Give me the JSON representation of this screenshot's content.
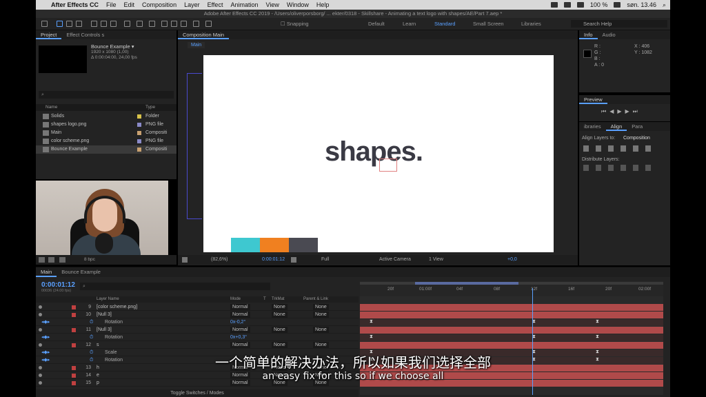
{
  "menubar": {
    "app": "After Effects CC",
    "items": [
      "File",
      "Edit",
      "Composition",
      "Layer",
      "Effect",
      "Animation",
      "View",
      "Window",
      "Help"
    ],
    "battery": "100 %",
    "clock": "søn. 13.46"
  },
  "window": {
    "title": "Adobe After Effects CC 2019 - /Users/oliverporsborg/ ... ekter/0318 - Skillshare - Animating a text logo with shapes/AE/Part 7.aep *"
  },
  "toolbar": {
    "snapping": "Snapping",
    "workspaces": [
      "Default",
      "Learn",
      "Standard",
      "Small Screen",
      "Libraries"
    ],
    "active_workspace": "Standard",
    "search_placeholder": "Search Help"
  },
  "project": {
    "tabs": [
      "Project",
      "Effect Controls s"
    ],
    "selected_name": "Bounce Example ▾",
    "selected_info": [
      "1920 x 1080 (1,00)",
      "Δ 0:00:04:00, 24,00 fps"
    ],
    "search_placeholder": "⌕",
    "col_name": "Name",
    "col_type": "Type",
    "items": [
      {
        "name": "Solids",
        "type": "Folder",
        "color": "#d8c24a"
      },
      {
        "name": "shapes logo.png",
        "type": "PNG file",
        "color": "#8a8ac8"
      },
      {
        "name": "Main",
        "type": "Compositi",
        "color": "#c8a070"
      },
      {
        "name": "color scheme.png",
        "type": "PNG file",
        "color": "#8a8ac8"
      },
      {
        "name": "Bounce Example",
        "type": "Compositi",
        "color": "#c8a070"
      }
    ],
    "bpc": "8 bpc"
  },
  "composition": {
    "tab": "Composition Main",
    "breadcrumb": "Main",
    "logo_text": "shapes",
    "logo_dot": ".",
    "swatches": [
      "#3ec8d0",
      "#f08020",
      "#4a4a52"
    ],
    "zoom": "(82,6%)",
    "timecode": "0:00:01:12",
    "resolution": "Full",
    "camera": "Active Camera",
    "views": "1 View",
    "exposure": "+0,0"
  },
  "info": {
    "tabs": [
      "Info",
      "Audio"
    ],
    "labels": [
      "R :",
      "G :",
      "B :",
      "A : 0"
    ],
    "x": "X : 406",
    "y": "Y : 1082"
  },
  "preview": {
    "title": "Preview"
  },
  "align": {
    "tabs": [
      "ibraries",
      "Align",
      "Para"
    ],
    "align_to_label": "Align Layers to:",
    "align_to_value": "Composition",
    "distribute": "Distribute Layers:"
  },
  "timeline": {
    "tabs": [
      "Main",
      "Bounce Example"
    ],
    "time": "0:00:01:12",
    "fps": "00036 (24.00 fps)",
    "headers": {
      "layer": "Layer Name",
      "mode": "Mode",
      "t": "T",
      "trkmat": "TrkMat",
      "parent": "Parent & Link"
    },
    "ruler": [
      "20f",
      "01:00f",
      "04f",
      "08f",
      "12f",
      "16f",
      "20f",
      "02:00f"
    ],
    "rows": [
      {
        "num": "9",
        "name": "[color scheme.png]",
        "mode": "Normal",
        "trk": "None",
        "parent": "None"
      },
      {
        "num": "10",
        "name": "[Null 3]",
        "mode": "Normal",
        "trk": "None",
        "parent": "None"
      },
      {
        "prop": "Rotation",
        "value": "0x-0,2°"
      },
      {
        "num": "11",
        "name": "[Null 3]",
        "mode": "Normal",
        "trk": "None",
        "parent": "None"
      },
      {
        "prop": "Rotation",
        "value": "0x+0,3°"
      },
      {
        "num": "12",
        "name": "s",
        "mode": "Normal",
        "trk": "None",
        "parent": "None"
      },
      {
        "prop": "Scale",
        "value": ""
      },
      {
        "prop": "Rotation",
        "value": ""
      },
      {
        "num": "13",
        "name": "h",
        "mode": "Normal",
        "trk": "None",
        "parent": "None"
      },
      {
        "num": "14",
        "name": "e",
        "mode": "Normal",
        "trk": "None",
        "parent": "None"
      },
      {
        "num": "15",
        "name": "p",
        "mode": "Normal",
        "trk": "None",
        "parent": "None"
      }
    ],
    "toggle": "Toggle Switches / Modes"
  },
  "subtitles": {
    "zh": "一个简单的解决办法，所以如果我们选择全部",
    "en": "an easy fix for this so if we choose all"
  }
}
